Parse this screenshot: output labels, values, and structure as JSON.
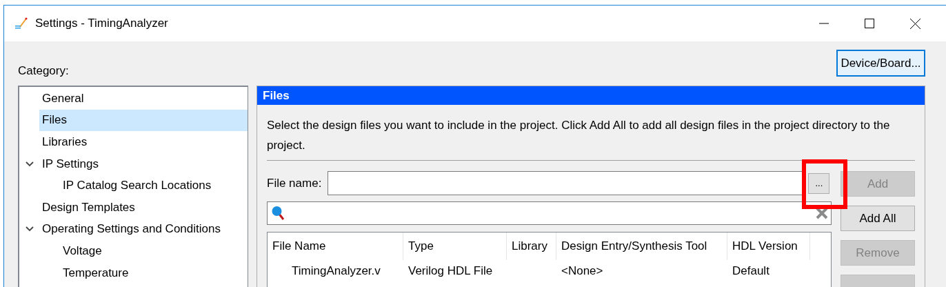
{
  "window": {
    "title": "Settings - TimingAnalyzer"
  },
  "category_label": "Category:",
  "device_button": {
    "label": "Device/Board..."
  },
  "categories": [
    {
      "label": "General",
      "selected": false
    },
    {
      "label": "Files",
      "selected": true
    },
    {
      "label": "Libraries",
      "selected": false
    },
    {
      "label": "IP Settings",
      "selected": false,
      "expanded": true,
      "children": [
        {
          "label": "IP Catalog Search Locations",
          "selected": false
        }
      ]
    },
    {
      "label": "Design Templates",
      "selected": false
    },
    {
      "label": "Operating Settings and Conditions",
      "selected": false,
      "expanded": true,
      "children": [
        {
          "label": "Voltage",
          "selected": false
        },
        {
          "label": "Temperature",
          "selected": false
        }
      ]
    }
  ],
  "panel": {
    "title": "Files",
    "description": "Select the design files you want to include in the project. Click Add All to add all design files in the project directory to the project.",
    "file_name_label": "File name:",
    "browse_button": "...",
    "buttons": [
      {
        "label": "Add",
        "disabled": true
      },
      {
        "label": "Add All",
        "disabled": false
      },
      {
        "label": "Remove",
        "disabled": true
      },
      {
        "disabled": true
      }
    ],
    "table": {
      "columns": [
        "File Name",
        "Type",
        "Library",
        "Design Entry/Synthesis Tool",
        "HDL Version"
      ],
      "rows": [
        {
          "cells": [
            "TimingAnalyzer.v",
            "Verilog HDL File",
            null,
            "<None>",
            "Default"
          ]
        }
      ]
    },
    "annotation": {
      "kind": "highlight"
    }
  }
}
